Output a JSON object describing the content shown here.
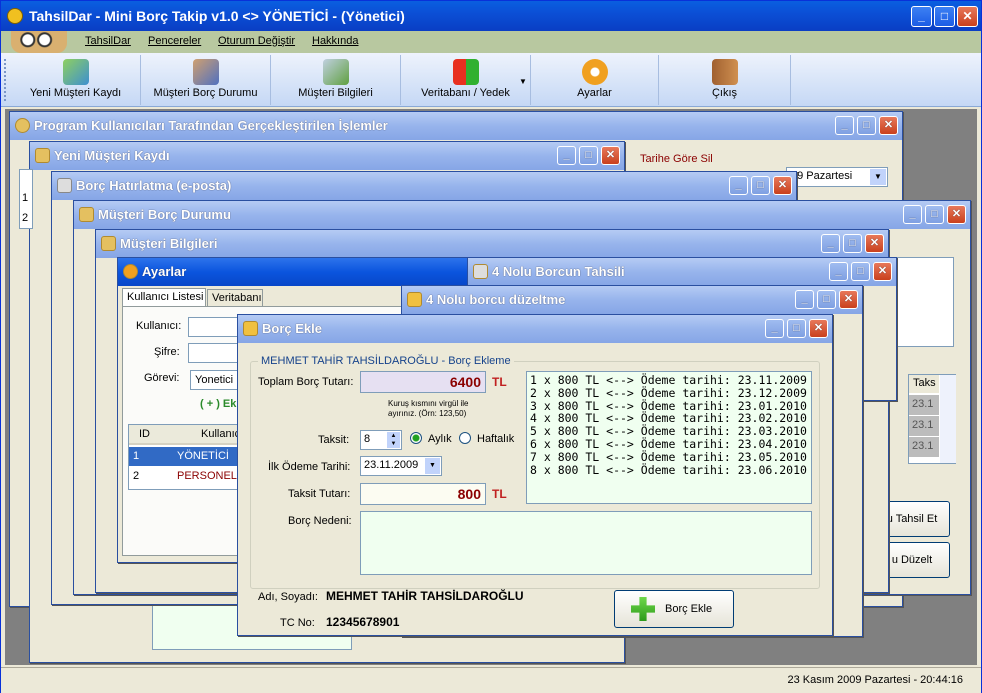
{
  "app": {
    "title": "TahsilDar - Mini Borç Takip v1.0 <> YÖNETİCİ - (Yönetici)"
  },
  "menu": [
    "TahsilDar",
    "Pencereler",
    "Oturum Değiştir",
    "Hakkında"
  ],
  "toolbar": [
    "Yeni Müşteri Kaydı",
    "Müşteri Borç Durumu",
    "Müşteri Bilgileri",
    "Veritabanı / Yedek",
    "Ayarlar",
    "Çıkış"
  ],
  "windows": {
    "islemler": "Program Kullanıcıları Tarafından Gerçekleştirilen İşlemler",
    "yeni_musteri": "Yeni Müşteri Kaydı",
    "hatirlatma": "Borç Hatırlatma (e-posta)",
    "borc_durumu": "Müşteri Borç Durumu",
    "bilgiler": "Müşteri Bilgileri",
    "ayarlar": "Ayarlar",
    "tahsil": "4 Nolu Borcun Tahsili",
    "duzeltme": "4 Nolu borcu düzeltme",
    "borc_ekle": "Borç Ekle"
  },
  "background": {
    "tarihe_gore_sil": "Tarihe Göre Sil",
    "tarih_combo": "09 Pazartesi",
    "taksit_header": "Taks",
    "taksit_rows": [
      "23.1",
      "23.1",
      "23.1"
    ],
    "tahsil_btn": "u Tahsil Et",
    "duzelt_btn": "u Düzelt",
    "row_nums": [
      "1",
      "2"
    ]
  },
  "ayarlar": {
    "tabs": [
      "Kullanıcı Listesi",
      "Veritabanı"
    ],
    "kullanici_label": "Kullanıcı:",
    "sifre_label": "Şifre:",
    "gorevi_label": "Görevi:",
    "gorevi_value": "Yonetici",
    "ekle_link": "( + ) Ekl",
    "cols": [
      "ID",
      "Kullanıcı"
    ],
    "rows": [
      {
        "id": "1",
        "name": "YÖNETİCİ"
      },
      {
        "id": "2",
        "name": "PERSONEL"
      }
    ]
  },
  "borc_ekle": {
    "group": "MEHMET TAHİR TAHSİLDAROĞLU - Borç Ekleme",
    "toplam_label": "Toplam Borç Tutarı:",
    "toplam_value": "6400",
    "currency": "TL",
    "hint": "Kuruş kısmını virgül ile ayırınız. (Örn: 123,50)",
    "taksit_label": "Taksit:",
    "taksit_value": "8",
    "aylik": "Aylık",
    "haftalik": "Haftalık",
    "ilk_odeme_label": "İlk Ödeme Tarihi:",
    "ilk_odeme_value": "23.11.2009",
    "taksit_tutari_label": "Taksit Tutarı:",
    "taksit_tutari_value": "800",
    "borc_nedeni_label": "Borç Nedeni:",
    "plan": [
      "1 x 800 TL <--> Ödeme tarihi: 23.11.2009",
      "2 x 800 TL <--> Ödeme tarihi: 23.12.2009",
      "3 x 800 TL <--> Ödeme tarihi: 23.01.2010",
      "4 x 800 TL <--> Ödeme tarihi: 23.02.2010",
      "5 x 800 TL <--> Ödeme tarihi: 23.03.2010",
      "6 x 800 TL <--> Ödeme tarihi: 23.04.2010",
      "7 x 800 TL <--> Ödeme tarihi: 23.05.2010",
      "8 x 800 TL <--> Ödeme tarihi: 23.06.2010"
    ],
    "adsoyad_label": "Adı, Soyadı:",
    "adsoyad_value": "MEHMET TAHİR TAHSİLDAROĞLU",
    "tc_label": "TC No:",
    "tc_value": "12345678901",
    "button": "Borç Ekle"
  },
  "status": "23 Kasım 2009 Pazartesi - 20:44:16"
}
